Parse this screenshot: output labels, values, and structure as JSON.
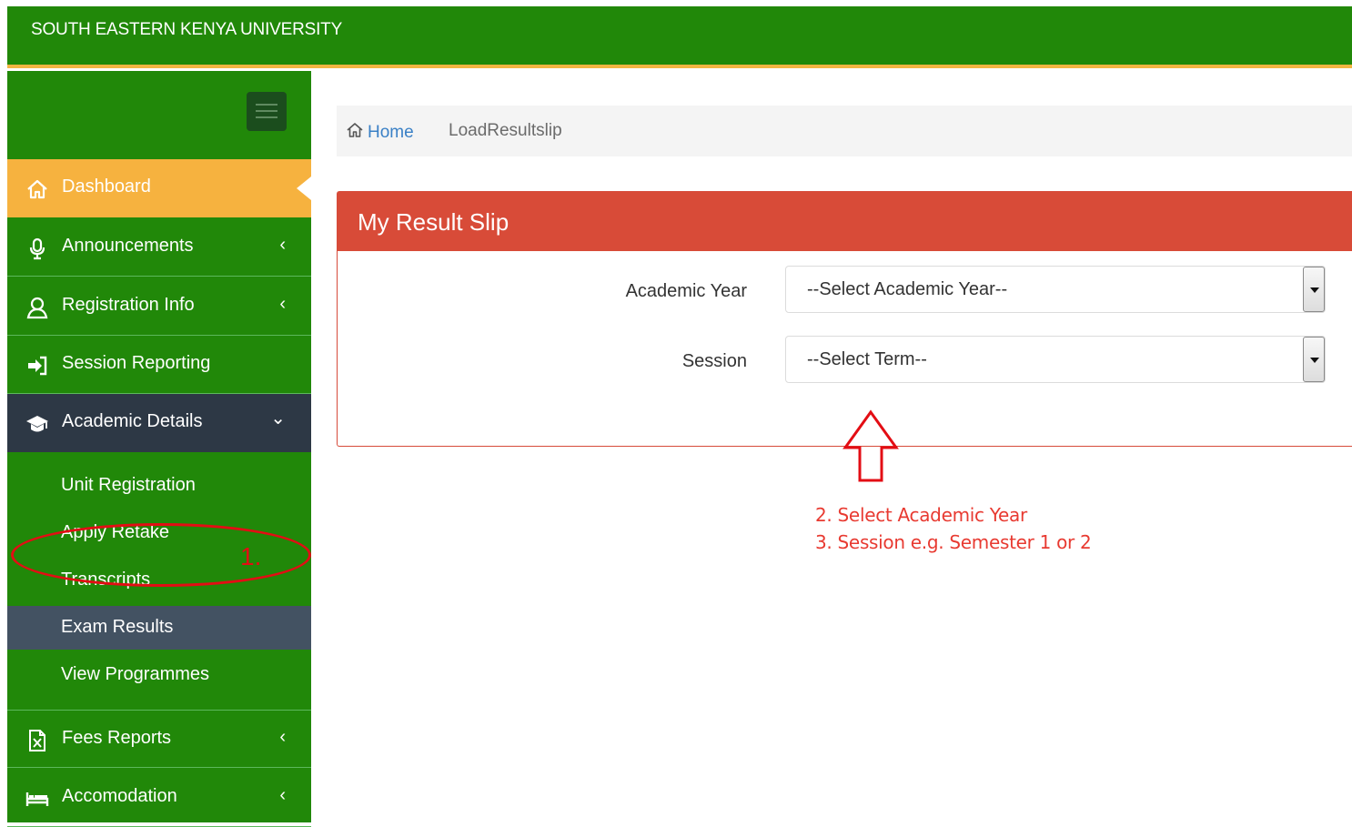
{
  "header": {
    "brand": "SOUTH EASTERN KENYA UNIVERSITY"
  },
  "sidebar": {
    "items": [
      {
        "label": "Dashboard",
        "icon": "home-icon",
        "state": "active"
      },
      {
        "label": "Announcements",
        "icon": "microphone-icon",
        "chevron": "‹"
      },
      {
        "label": "Registration Info",
        "icon": "user-icon",
        "chevron": "‹"
      },
      {
        "label": "Session Reporting",
        "icon": "sign-in-icon"
      },
      {
        "label": "Academic Details",
        "icon": "graduation-cap-icon",
        "chevron": "⌄",
        "state": "expanded"
      },
      {
        "label": "Fees Reports",
        "icon": "excel-file-icon",
        "chevron": "‹"
      },
      {
        "label": "Accomodation",
        "icon": "bed-icon",
        "chevron": "‹"
      }
    ],
    "subitems": [
      {
        "label": "Unit Registration"
      },
      {
        "label": "Apply Retake"
      },
      {
        "label": "Transcripts"
      },
      {
        "label": "Exam Results",
        "state": "selected"
      },
      {
        "label": "View Programmes"
      }
    ]
  },
  "breadcrumb": {
    "home": "Home",
    "current": "LoadResultslip"
  },
  "panel": {
    "title": "My Result Slip",
    "fields": [
      {
        "label": "Academic Year",
        "value": "--Select Academic Year--"
      },
      {
        "label": "Session",
        "value": "--Select Term--"
      }
    ]
  },
  "annotations": {
    "step1": "1.",
    "step2": "2. Select Academic Year",
    "step3": "3. Session e.g. Semester 1 or 2"
  },
  "colors": {
    "brand_green": "#218809",
    "accent_orange": "#f6b23f",
    "panel_red": "#d84b38",
    "annotation_red": "#e30d14",
    "dark_nav": "#2d3845"
  }
}
